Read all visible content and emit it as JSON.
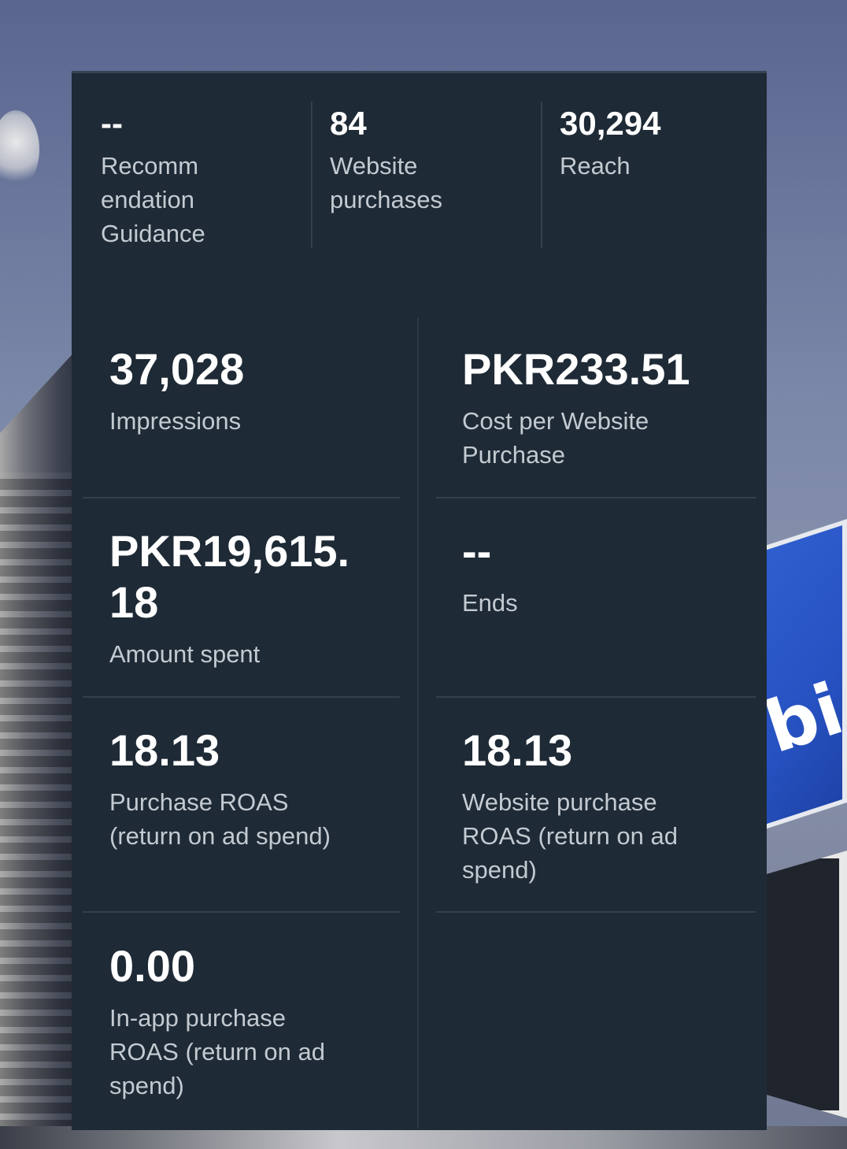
{
  "top_metrics": [
    {
      "value": "--",
      "label": [
        "Recomm",
        "endation",
        "Guidance"
      ]
    },
    {
      "value": "84",
      "label": [
        "Website",
        "purchases"
      ]
    },
    {
      "value": "30,294",
      "label": [
        "Reach"
      ]
    }
  ],
  "metrics": {
    "impressions": {
      "value": "37,028",
      "label": "Impressions"
    },
    "cost_per_purchase": {
      "value": "PKR233.51",
      "label_lines": [
        "Cost per Website",
        "Purchase"
      ]
    },
    "amount_spent": {
      "value_lines": [
        "PKR19,615.",
        "18"
      ],
      "label": "Amount spent"
    },
    "ends": {
      "value": "--",
      "label": "Ends"
    },
    "purchase_roas": {
      "value": "18.13",
      "label_lines": [
        "Purchase ROAS",
        "(return on ad spend)"
      ]
    },
    "website_purchase_roas": {
      "value": "18.13",
      "label_lines": [
        "Website purchase",
        "ROAS (return on ad",
        "spend)"
      ]
    },
    "in_app_purchase_roas": {
      "value": "0.00",
      "label_lines": [
        "In-app purchase",
        "ROAS (return on ad",
        "spend)"
      ]
    }
  },
  "background": {
    "sign_text": "bi"
  },
  "colors": {
    "card_bg": "#1e2a35",
    "label_text": "#c3cad1",
    "value_text": "#ffffff",
    "divider": "#34414d"
  }
}
